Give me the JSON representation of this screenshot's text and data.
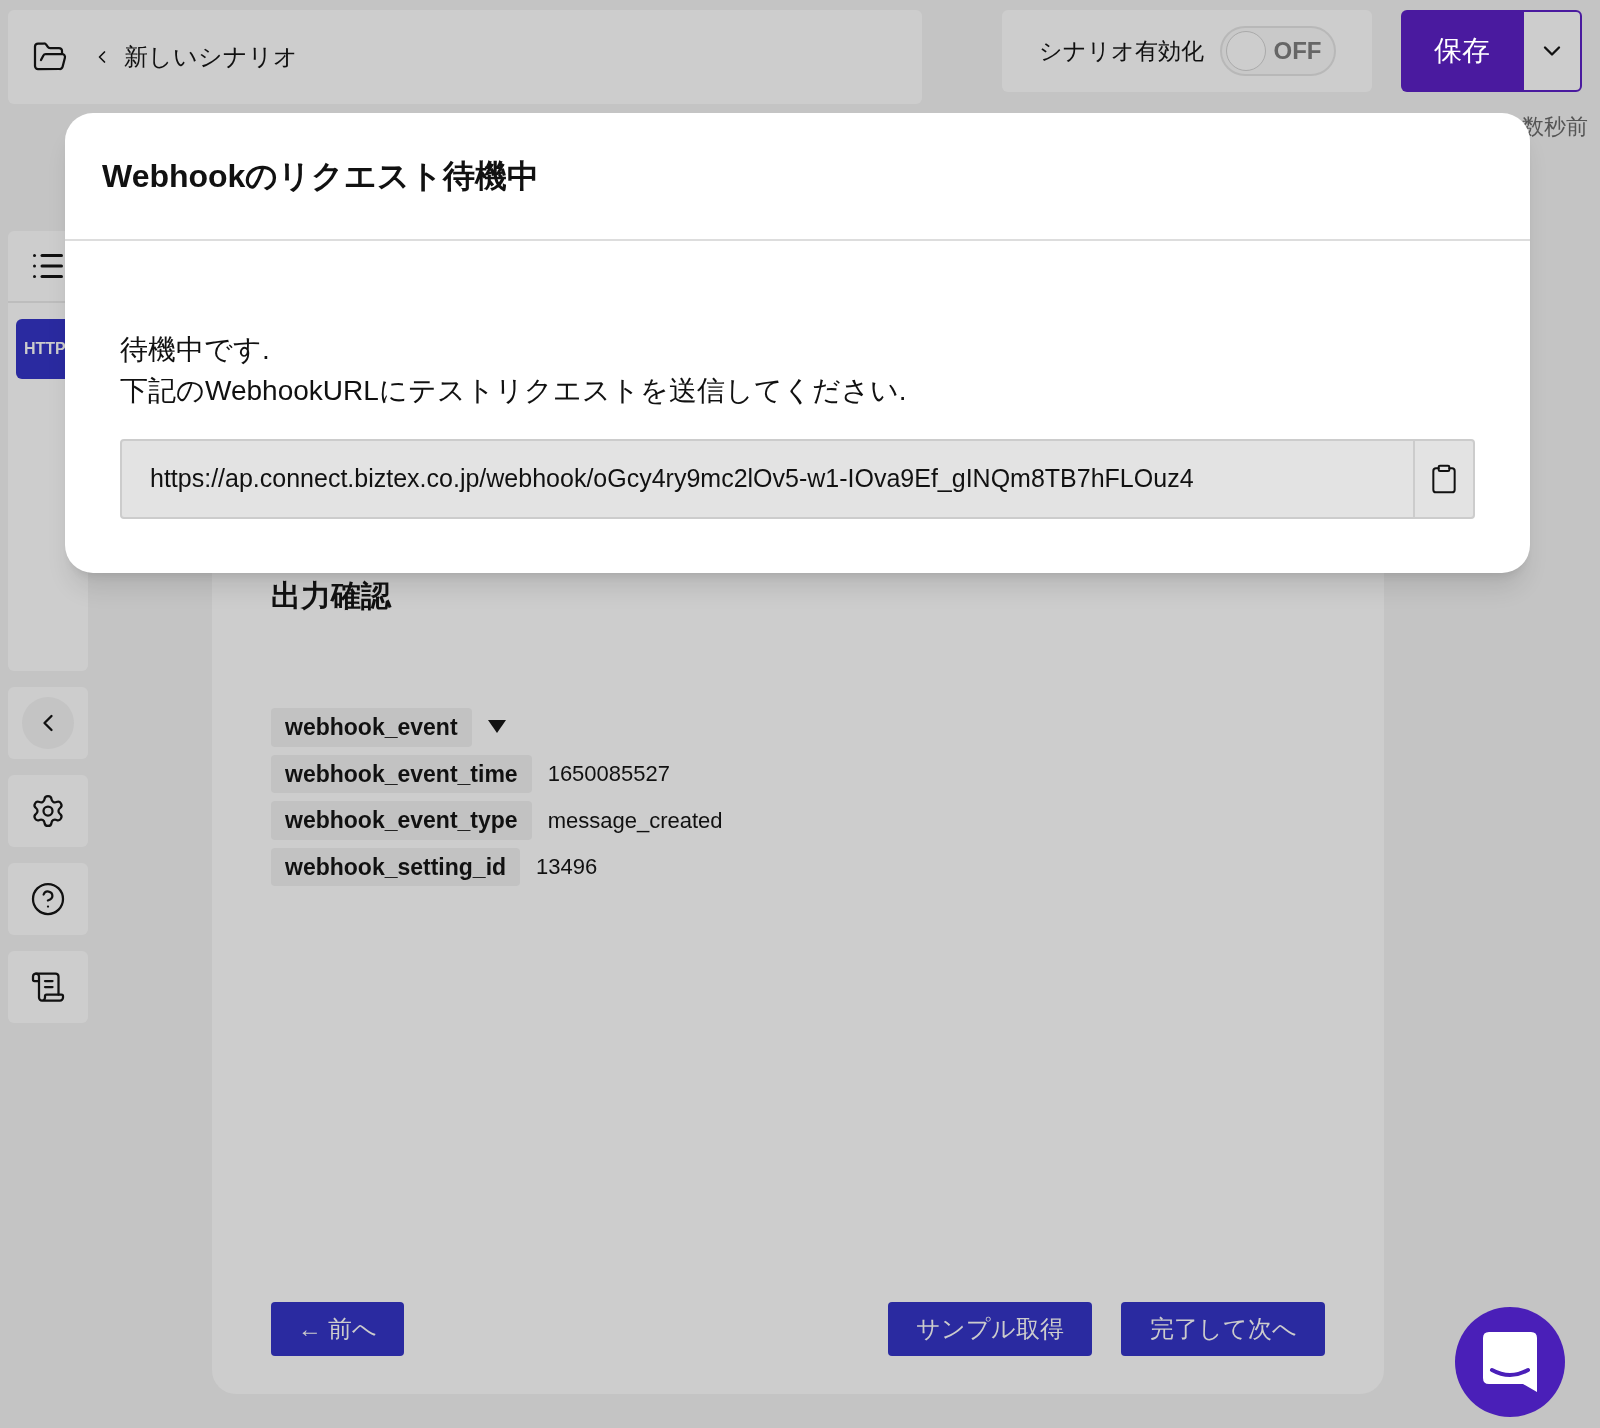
{
  "header": {
    "title": "新しいシナリオ"
  },
  "enable": {
    "label": "シナリオ有効化",
    "on": false,
    "state_text": "OFF"
  },
  "save_button": "保存",
  "last_updated": "数秒前",
  "sidebar": {
    "badge": "HTTP"
  },
  "main": {
    "heading": "出力確認",
    "fields": [
      {
        "kind": "object",
        "key": "webhook_event"
      },
      {
        "kind": "value",
        "key": "webhook_event_time",
        "value": "1650085527"
      },
      {
        "kind": "value",
        "key": "webhook_event_type",
        "value": "message_created"
      },
      {
        "kind": "value",
        "key": "webhook_setting_id",
        "value": "13496"
      }
    ],
    "buttons": [
      "← 前へ",
      "サンプル取得",
      "完了して次へ"
    ]
  },
  "modal": {
    "title": "Webhookのリクエスト待機中",
    "message": [
      "待機中です.",
      "下記のWebhookURLにテストリクエストを送信してください."
    ],
    "url": "https://ap.connect.biztex.co.jp/webhook/oGcy4ry9mc2lOv5-w1-IOva9Ef_gINQm8TB7hFLOuz4"
  }
}
